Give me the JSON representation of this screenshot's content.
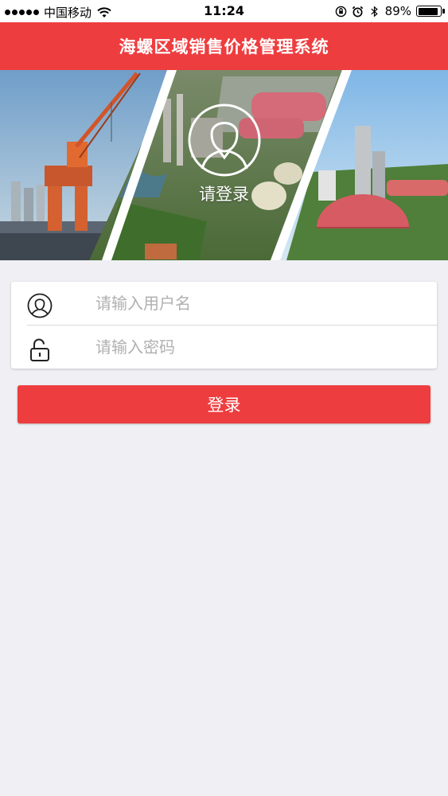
{
  "status_bar": {
    "carrier": "中国移动",
    "time": "11:24",
    "battery_percent": "89%",
    "battery_level": 0.89
  },
  "header": {
    "title": "海螺区域销售价格管理系统"
  },
  "banner": {
    "caption": "请登录"
  },
  "form": {
    "username_placeholder": "请输入用户名",
    "password_placeholder": "请输入密码",
    "username_value": "",
    "password_value": ""
  },
  "login_button": {
    "label": "登录"
  },
  "colors": {
    "accent": "#ee3d3f",
    "background": "#efeff4"
  },
  "icons": {
    "username": "user-circle-icon",
    "password": "unlocked-padlock-icon",
    "avatar": "user-avatar-icon"
  }
}
